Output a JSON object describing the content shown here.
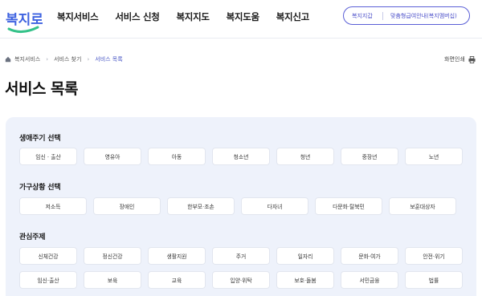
{
  "header": {
    "logo_text": "복지로",
    "nav": [
      "복지서비스",
      "서비스 신청",
      "복지지도",
      "복지도움",
      "복지신고"
    ],
    "pill_left": "복지지갑",
    "pill_right": "맞춤형급여안내(복지멤버십)"
  },
  "breadcrumb": {
    "items": [
      "복지서비스",
      "서비스 찾기",
      "서비스 목록"
    ]
  },
  "print_label": "화면인쇄",
  "page_title": "서비스 목록",
  "filters": {
    "life_cycle": {
      "title": "생애주기 선택",
      "options": [
        "임신 · 출산",
        "영유아",
        "아동",
        "청소년",
        "청년",
        "중장년",
        "노년"
      ]
    },
    "household": {
      "title": "가구상황 선택",
      "options": [
        "저소득",
        "장애인",
        "한부모·조손",
        "다자녀",
        "다문화·탈북민",
        "보훈대상자"
      ]
    },
    "interest": {
      "title": "관심주제",
      "options_row1": [
        "신체건강",
        "정신건강",
        "생활지원",
        "주거",
        "일자리",
        "문화·여가",
        "안전·위기"
      ],
      "options_row2": [
        "임신·출산",
        "보육",
        "교육",
        "입양·위탁",
        "보호·돌봄",
        "서민금융",
        "법률"
      ]
    }
  },
  "colors": {
    "accent": "#4b4fc9",
    "panel_bg": "#eef2fb",
    "logo_blue": "#3f63e0",
    "logo_green": "#35c28a"
  }
}
